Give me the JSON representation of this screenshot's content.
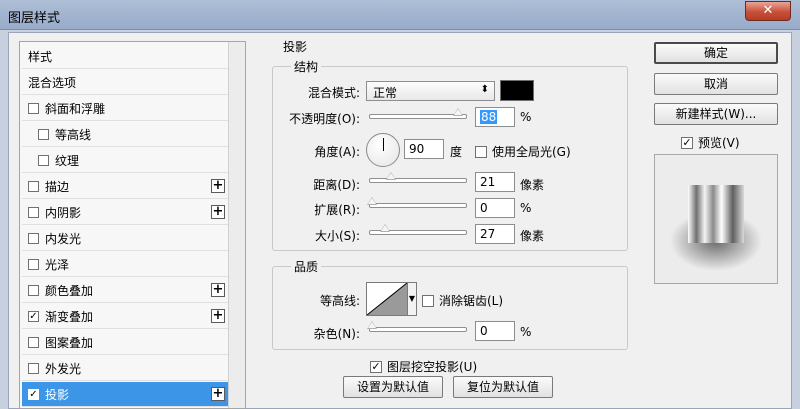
{
  "window": {
    "title": "图层样式",
    "close": "✕"
  },
  "styles_list": {
    "items": [
      {
        "label": "样式",
        "has_checkbox": false,
        "checked": false,
        "has_plus": false,
        "indent": false,
        "selected": false
      },
      {
        "label": "混合选项",
        "has_checkbox": false,
        "checked": false,
        "has_plus": false,
        "indent": false,
        "selected": false
      },
      {
        "label": "斜面和浮雕",
        "has_checkbox": true,
        "checked": false,
        "has_plus": false,
        "indent": false,
        "selected": false
      },
      {
        "label": "等高线",
        "has_checkbox": true,
        "checked": false,
        "has_plus": false,
        "indent": true,
        "selected": false
      },
      {
        "label": "纹理",
        "has_checkbox": true,
        "checked": false,
        "has_plus": false,
        "indent": true,
        "selected": false
      },
      {
        "label": "描边",
        "has_checkbox": true,
        "checked": false,
        "has_plus": true,
        "indent": false,
        "selected": false
      },
      {
        "label": "内阴影",
        "has_checkbox": true,
        "checked": false,
        "has_plus": true,
        "indent": false,
        "selected": false
      },
      {
        "label": "内发光",
        "has_checkbox": true,
        "checked": false,
        "has_plus": false,
        "indent": false,
        "selected": false
      },
      {
        "label": "光泽",
        "has_checkbox": true,
        "checked": false,
        "has_plus": false,
        "indent": false,
        "selected": false
      },
      {
        "label": "颜色叠加",
        "has_checkbox": true,
        "checked": false,
        "has_plus": true,
        "indent": false,
        "selected": false
      },
      {
        "label": "渐变叠加",
        "has_checkbox": true,
        "checked": true,
        "has_plus": true,
        "indent": false,
        "selected": false
      },
      {
        "label": "图案叠加",
        "has_checkbox": true,
        "checked": false,
        "has_plus": false,
        "indent": false,
        "selected": false
      },
      {
        "label": "外发光",
        "has_checkbox": true,
        "checked": false,
        "has_plus": false,
        "indent": false,
        "selected": false
      },
      {
        "label": "投影",
        "has_checkbox": true,
        "checked": true,
        "has_plus": true,
        "indent": false,
        "selected": true
      }
    ]
  },
  "drop_shadow": {
    "section_title": "投影",
    "structure": {
      "title": "结构",
      "blend_mode_label": "混合模式:",
      "blend_mode_value": "正常",
      "blend_color": "#000000",
      "opacity_label": "不透明度(O):",
      "opacity_value": "88",
      "opacity_unit": "%",
      "angle_label": "角度(A):",
      "angle_value": "90",
      "angle_unit": "度",
      "global_light_label": "使用全局光(G)",
      "global_light_checked": false,
      "distance_label": "距离(D):",
      "distance_value": "21",
      "distance_unit": "像素",
      "spread_label": "扩展(R):",
      "spread_value": "0",
      "spread_unit": "%",
      "size_label": "大小(S):",
      "size_value": "27",
      "size_unit": "像素"
    },
    "quality": {
      "title": "品质",
      "contour_label": "等高线:",
      "antialias_label": "消除锯齿(L)",
      "antialias_checked": false,
      "noise_label": "杂色(N):",
      "noise_value": "0",
      "noise_unit": "%"
    },
    "knockout_label": "图层挖空投影(U)",
    "knockout_checked": true,
    "make_default_label": "设置为默认值",
    "reset_default_label": "复位为默认值"
  },
  "actions": {
    "ok_label": "确定",
    "cancel_label": "取消",
    "new_style_label": "新建样式(W)...",
    "preview_label": "预览(V)",
    "preview_checked": true
  },
  "colors": {
    "selected_row": "#3d95e8"
  }
}
